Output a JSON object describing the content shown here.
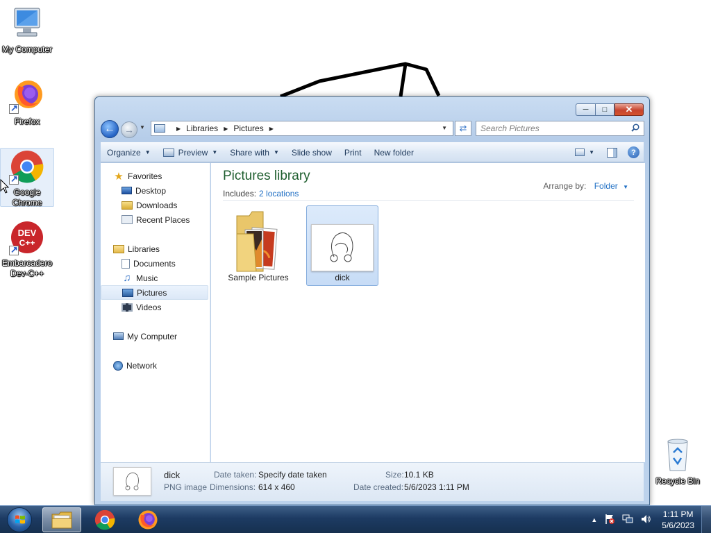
{
  "desktop": {
    "icons": [
      {
        "label": "My Computer"
      },
      {
        "label": "Firefox"
      },
      {
        "label": "Google Chrome"
      },
      {
        "label": "Embarcadero Dev-C++"
      },
      {
        "label": "Recycle Bin"
      }
    ]
  },
  "window": {
    "breadcrumb": [
      "Libraries",
      "Pictures"
    ],
    "search_placeholder": "Search Pictures",
    "toolbar": {
      "organize": "Organize",
      "preview": "Preview",
      "share_with": "Share with",
      "slide_show": "Slide show",
      "print": "Print",
      "new_folder": "New folder"
    },
    "nav_pane": {
      "favorites": "Favorites",
      "desktop": "Desktop",
      "downloads": "Downloads",
      "recent_places": "Recent Places",
      "libraries": "Libraries",
      "documents": "Documents",
      "music": "Music",
      "pictures": "Pictures",
      "videos": "Videos",
      "my_computer": "My Computer",
      "network": "Network"
    },
    "library": {
      "title": "Pictures library",
      "includes_label": "Includes:",
      "locations_link": "2 locations",
      "arrange_label": "Arrange by:",
      "arrange_value": "Folder"
    },
    "items": [
      {
        "name": "Sample Pictures",
        "kind": "folder"
      },
      {
        "name": "dick",
        "kind": "image",
        "selected": true
      }
    ],
    "details": {
      "file_name": "dick",
      "file_type": "PNG image",
      "date_taken_label": "Date taken:",
      "date_taken_value": "Specify date taken",
      "dimensions_label": "Dimensions:",
      "dimensions_value": "614 x 460",
      "size_label": "Size:",
      "size_value": "10.1 KB",
      "date_created_label": "Date created:",
      "date_created_value": "5/6/2023 1:11 PM"
    }
  },
  "taskbar": {
    "apps": [
      "windows-explorer",
      "google-chrome",
      "firefox"
    ],
    "active_app": "windows-explorer",
    "clock_time": "1:11 PM",
    "clock_date": "5/6/2023"
  },
  "colors": {
    "library_title": "#1e5e2e",
    "link_blue": "#1f6fc4",
    "taskbar": "#1d3b63",
    "selection": "#c7dcf6"
  }
}
